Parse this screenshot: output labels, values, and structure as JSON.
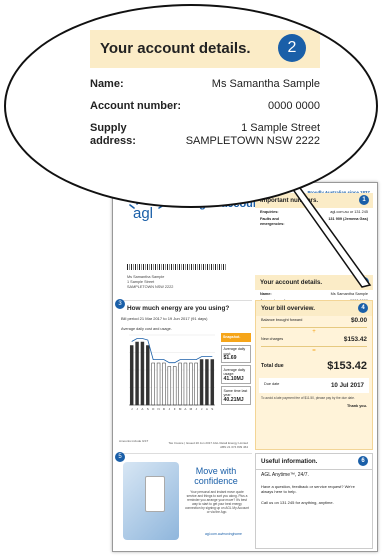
{
  "zoom": {
    "title": "Your account details.",
    "number": "2",
    "rows": [
      {
        "label": "Name:",
        "value": "Ms Samantha Sample"
      },
      {
        "label": "Account number:",
        "value": "0000 0000"
      }
    ],
    "address_label_1": "Supply",
    "address_label_2": "address:",
    "address_line_1": "1 Sample Street",
    "address_line_2": "SAMPLETOWN NSW 2222"
  },
  "bill": {
    "tagline": "Proudly Australian since 1837.",
    "logo_text": "agl",
    "product": "AGL gas account",
    "recipient": [
      "Ms Samantha Sample",
      "1 Sample Street",
      "SAMPLETOWN NSW 2222"
    ],
    "important": {
      "title": "Important numbers.",
      "number": "1",
      "rows": [
        {
          "label": "Enquiries:",
          "value": "agl.com.au or 131 245"
        },
        {
          "label": "Faults and emergencies:",
          "value": "131 909 (Jemena Gas)"
        }
      ]
    },
    "account": {
      "title": "Your account details.",
      "number": "2",
      "rows": [
        {
          "label": "Name:",
          "value": "Ms Samantha Sample"
        },
        {
          "label": "Account number:",
          "value": "0000 0000"
        },
        {
          "label": "Supply address:",
          "value": "1 Sample Street SAMPLETOWN NSW 2222"
        }
      ]
    },
    "usage": {
      "number": "3",
      "title": "How much energy are you using?",
      "period": "Bill period 21 Mar 2017 to 19 Jun 2017 (91 days)",
      "chart_label": "Average daily cost and usage.",
      "snapshot_title": "Snapshot.",
      "avg_cost_label": "Average daily cost:",
      "avg_cost": "$1.69",
      "avg_usage_label": "Average daily usage:",
      "avg_usage": "41.10MJ",
      "last_year_label": "Same time last year:",
      "last_year": "40.21MJ"
    },
    "overview": {
      "title": "Your bill overview.",
      "number": "4",
      "balance_label": "Balance brought forward",
      "balance": "$0.00",
      "new_charges_label": "New charges",
      "new_charges": "$153.42",
      "total_label": "Total due",
      "total": "$153.42",
      "due_label": "Due date",
      "due_date": "10 Jul 2017",
      "fine": "To avoid a late payment fee of $11.50, please pay by the due date.",
      "thanks": "Thank you."
    },
    "promo": {
      "number": "5",
      "title": "Move with confidence",
      "text": "Your personal and instant move quote service and things to sort you along. Plus a reminder you arrange your move? It's best way to start to get your best energy connection by signing up on AGL My Account or via the App.",
      "link": "agl.com.au/movinghome"
    },
    "useful": {
      "title": "Useful information.",
      "number": "6",
      "line1": "AGL Anytime™, 24/7.",
      "line2": "Have a question, feedback or service request? We're always here to help.",
      "line3": "Call us on 131 245 for anything, anytime."
    },
    "footer_left": "Amounts include GST",
    "footer_right": "Tax Invoice | Issued 20 Jun 2017 AGL Retail Energy Limited ABN 21 074 839 464"
  },
  "chart_data": {
    "type": "bar",
    "categories": [
      "J",
      "J",
      "A",
      "S",
      "O",
      "N",
      "D",
      "J",
      "F",
      "M",
      "A",
      "M",
      "J",
      "J",
      "A",
      "S"
    ],
    "series": [
      {
        "name": "Average daily cost",
        "values": [
          1.7,
          1.8,
          1.8,
          1.7,
          1.2,
          1.2,
          1.2,
          1.1,
          1.1,
          1.2,
          1.2,
          1.2,
          1.2,
          1.3,
          1.3,
          1.3
        ]
      },
      {
        "name": "Average daily usage",
        "values": [
          42,
          44,
          44,
          43,
          30,
          30,
          30,
          28,
          28,
          30,
          30,
          30,
          30,
          32,
          32,
          32
        ]
      }
    ],
    "ylabel": "",
    "ylim": [
      0,
      2
    ]
  },
  "colors": {
    "brand": "#1a5fa8",
    "accent": "#f6a519",
    "panel": "#fbecc7"
  }
}
